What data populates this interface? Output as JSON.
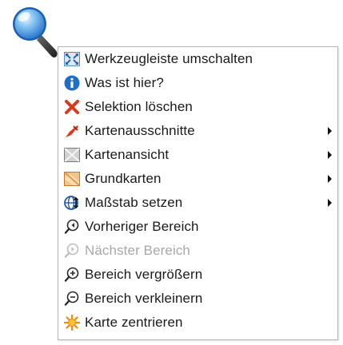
{
  "context_menu": {
    "items": [
      {
        "label": "Werkzeugleiste umschalten",
        "icon": "toolbar-toggle-icon",
        "submenu": false,
        "enabled": true
      },
      {
        "label": "Was ist hier?",
        "icon": "info-icon",
        "submenu": false,
        "enabled": true
      },
      {
        "label": "Selektion löschen",
        "icon": "red-x-icon",
        "submenu": false,
        "enabled": true
      },
      {
        "label": "Kartenausschnitte",
        "icon": "red-pin-icon",
        "submenu": true,
        "enabled": true
      },
      {
        "label": "Kartenansicht",
        "icon": "map-view-icon",
        "submenu": true,
        "enabled": true
      },
      {
        "label": "Grundkarten",
        "icon": "base-map-icon",
        "submenu": true,
        "enabled": true
      },
      {
        "label": "Maßstab setzen",
        "icon": "globe-scale-icon",
        "submenu": true,
        "enabled": true
      },
      {
        "label": "Vorheriger Bereich",
        "icon": "zoom-previous-icon",
        "submenu": false,
        "enabled": true
      },
      {
        "label": "Nächster Bereich",
        "icon": "zoom-next-icon",
        "submenu": false,
        "enabled": false
      },
      {
        "label": "Bereich vergrößern",
        "icon": "zoom-in-icon",
        "submenu": false,
        "enabled": true
      },
      {
        "label": "Bereich verkleinern",
        "icon": "zoom-out-icon",
        "submenu": false,
        "enabled": true
      },
      {
        "label": "Karte zentrieren",
        "icon": "center-map-icon",
        "submenu": false,
        "enabled": true
      }
    ]
  },
  "marker": {
    "icon": "magnifier-pin-icon"
  },
  "colors": {
    "disabled_text": "#a8a8a8",
    "text": "#1a1a1a",
    "border": "#b5b5b5",
    "accent_blue": "#2a7fd0",
    "accent_red": "#d93a1e"
  }
}
